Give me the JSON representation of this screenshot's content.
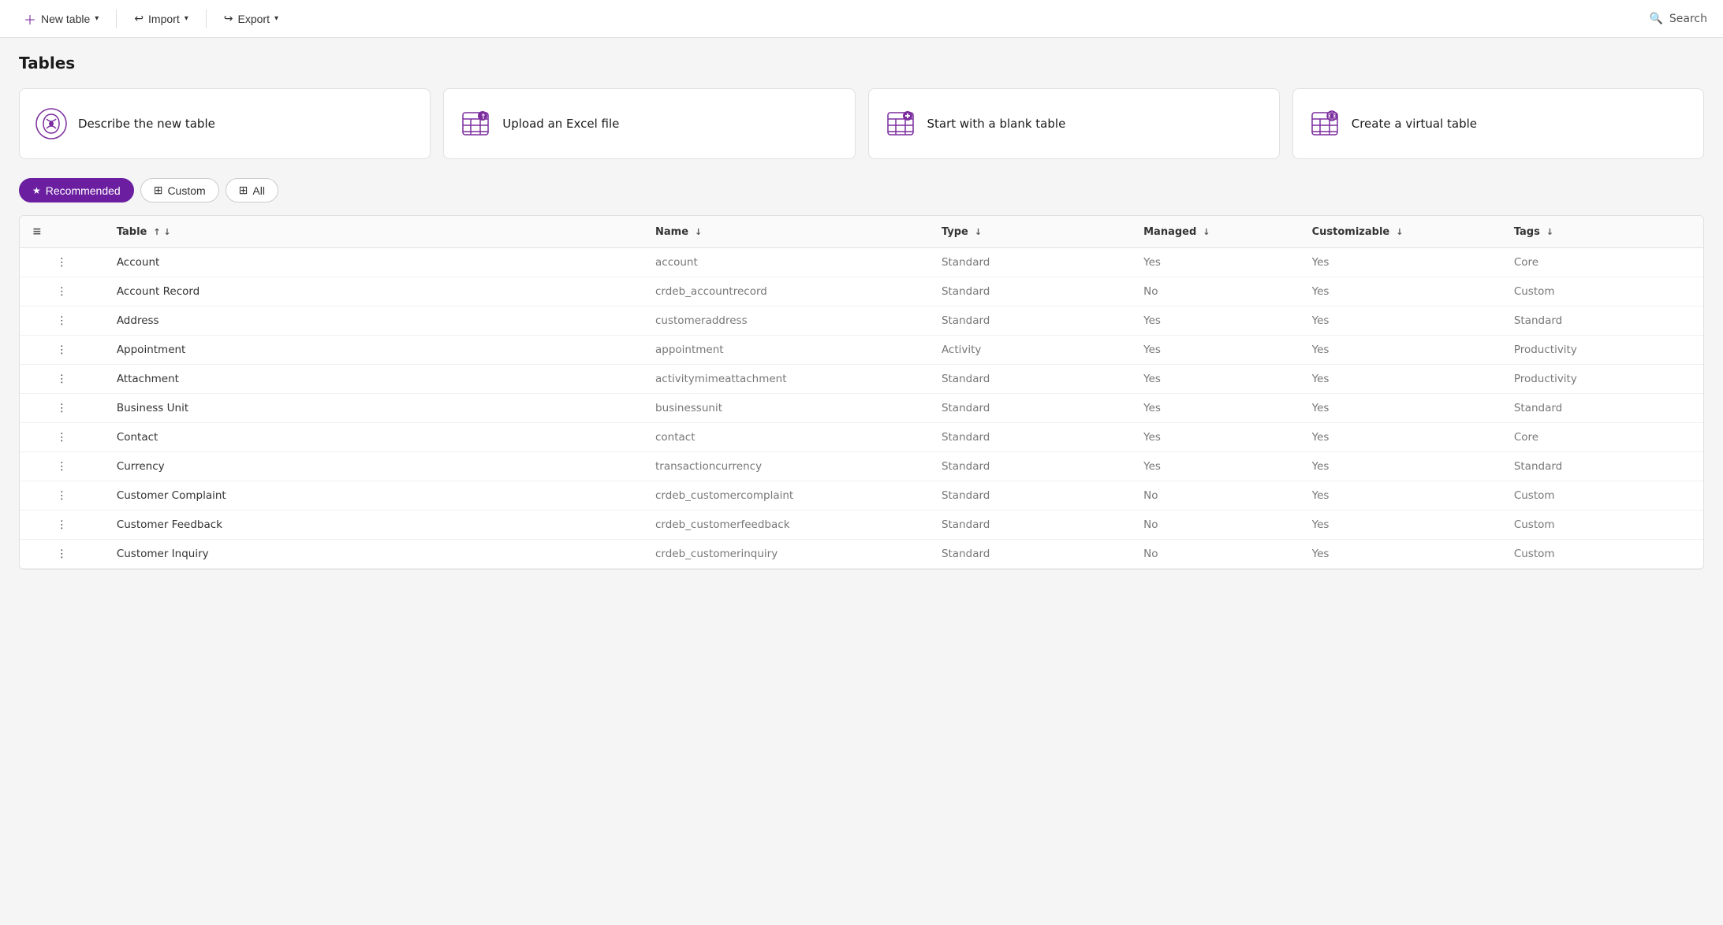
{
  "topbar": {
    "new_table_label": "New table",
    "import_label": "Import",
    "export_label": "Export",
    "search_label": "Search"
  },
  "page": {
    "title": "Tables"
  },
  "action_cards": [
    {
      "id": "describe",
      "label": "Describe the new table",
      "icon": "ai-icon"
    },
    {
      "id": "upload",
      "label": "Upload an Excel file",
      "icon": "upload-icon"
    },
    {
      "id": "blank",
      "label": "Start with a blank table",
      "icon": "add-table-icon"
    },
    {
      "id": "virtual",
      "label": "Create a virtual table",
      "icon": "virtual-table-icon"
    }
  ],
  "filters": [
    {
      "id": "recommended",
      "label": "Recommended",
      "active": true,
      "icon": "star"
    },
    {
      "id": "custom",
      "label": "Custom",
      "active": false,
      "icon": "grid"
    },
    {
      "id": "all",
      "label": "All",
      "active": false,
      "icon": "grid"
    }
  ],
  "table": {
    "columns": [
      {
        "id": "table",
        "label": "Table",
        "sortable": true,
        "sort_dir": "asc"
      },
      {
        "id": "name",
        "label": "Name",
        "sortable": true
      },
      {
        "id": "type",
        "label": "Type",
        "sortable": true
      },
      {
        "id": "managed",
        "label": "Managed",
        "sortable": true
      },
      {
        "id": "customizable",
        "label": "Customizable",
        "sortable": true
      },
      {
        "id": "tags",
        "label": "Tags",
        "sortable": true
      }
    ],
    "rows": [
      {
        "table": "Account",
        "name": "account",
        "type": "Standard",
        "managed": "Yes",
        "customizable": "Yes",
        "tags": "Core"
      },
      {
        "table": "Account Record",
        "name": "crdeb_accountrecord",
        "type": "Standard",
        "managed": "No",
        "customizable": "Yes",
        "tags": "Custom"
      },
      {
        "table": "Address",
        "name": "customeraddress",
        "type": "Standard",
        "managed": "Yes",
        "customizable": "Yes",
        "tags": "Standard"
      },
      {
        "table": "Appointment",
        "name": "appointment",
        "type": "Activity",
        "managed": "Yes",
        "customizable": "Yes",
        "tags": "Productivity"
      },
      {
        "table": "Attachment",
        "name": "activitymimeattachment",
        "type": "Standard",
        "managed": "Yes",
        "customizable": "Yes",
        "tags": "Productivity"
      },
      {
        "table": "Business Unit",
        "name": "businessunit",
        "type": "Standard",
        "managed": "Yes",
        "customizable": "Yes",
        "tags": "Standard"
      },
      {
        "table": "Contact",
        "name": "contact",
        "type": "Standard",
        "managed": "Yes",
        "customizable": "Yes",
        "tags": "Core"
      },
      {
        "table": "Currency",
        "name": "transactioncurrency",
        "type": "Standard",
        "managed": "Yes",
        "customizable": "Yes",
        "tags": "Standard"
      },
      {
        "table": "Customer Complaint",
        "name": "crdeb_customercomplaint",
        "type": "Standard",
        "managed": "No",
        "customizable": "Yes",
        "tags": "Custom"
      },
      {
        "table": "Customer Feedback",
        "name": "crdeb_customerfeedback",
        "type": "Standard",
        "managed": "No",
        "customizable": "Yes",
        "tags": "Custom"
      },
      {
        "table": "Customer Inquiry",
        "name": "crdeb_customerinquiry",
        "type": "Standard",
        "managed": "No",
        "customizable": "Yes",
        "tags": "Custom"
      }
    ]
  },
  "colors": {
    "accent": "#6b1fa0",
    "accent_light": "#f5eefb"
  }
}
